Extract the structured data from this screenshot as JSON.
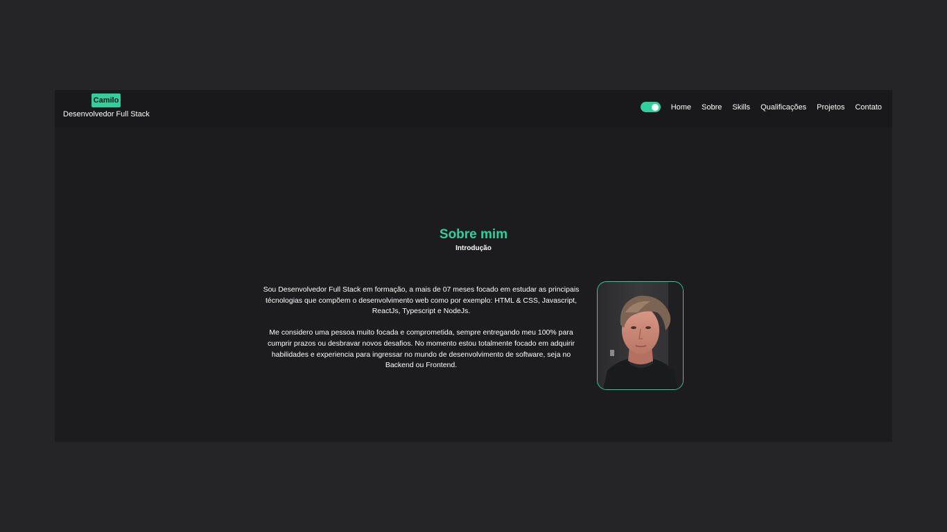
{
  "header": {
    "brand_name": "Camilo",
    "brand_role": "Desenvolvedor Full Stack",
    "nav": [
      "Home",
      "Sobre",
      "Skills",
      "Qualificações",
      "Projetos",
      "Contato"
    ]
  },
  "about": {
    "title": "Sobre mim",
    "subtitle": "Introdução",
    "paragraphs": [
      "Sou Desenvolvedor Full Stack em formação, a mais de 07 meses focado em estudar as principais técnologias que compõem o desenvolvimento web como por exemplo: HTML & CSS, Javascript, ReactJs, Typescript e NodeJs.",
      "Me considero uma pessoa muito focada e comprometida, sempre entregando meu 100% para cumprir prazos ou desbravar novos desafios. No momento estou totalmente focado em adquirir habilidades e experiencia para ingressar no mundo de desenvolvimento de software, seja no Backend ou Frontend."
    ]
  },
  "colors": {
    "accent": "#2fd09e",
    "page_background": "#252527",
    "section_background": "#1c1c1e"
  }
}
